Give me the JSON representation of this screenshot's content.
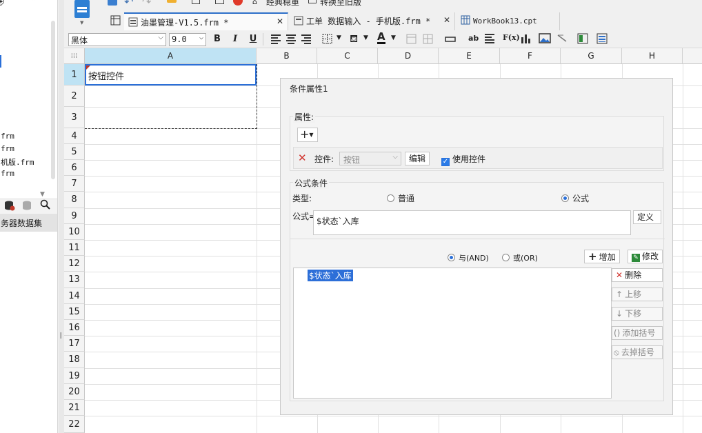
{
  "left_panel": {
    "files": [
      "frm",
      "frm",
      "机版.frm",
      "frm"
    ],
    "datasource_label": "务器数据集"
  },
  "toolbar": {
    "classic_label": "经典稳重",
    "old_version_label": "转换至旧版"
  },
  "tabs": [
    {
      "label": "油墨管理-V1.5.frm *",
      "active": true,
      "closable": true
    },
    {
      "label": "工单 数据输入 - 手机版.frm *",
      "active": false,
      "closable": true
    },
    {
      "label": "WorkBook13.cpt",
      "active": false,
      "closable": false
    }
  ],
  "format_bar": {
    "font": "黑体",
    "size": "9.0",
    "bold": "B",
    "italic": "I",
    "underline": "U"
  },
  "sheet": {
    "corner": "⁞⁞⁞",
    "columns": [
      "A",
      "B",
      "C",
      "D",
      "E",
      "F",
      "G",
      "H"
    ],
    "rows": [
      "1",
      "2",
      "3",
      "4",
      "5",
      "6",
      "7",
      "8",
      "9",
      "10",
      "11",
      "12",
      "13",
      "14",
      "15",
      "16",
      "17",
      "18",
      "19",
      "20",
      "21",
      "22"
    ],
    "cell_a1": "按钮控件"
  },
  "dialog": {
    "title": "条件属性1",
    "property_label": "属性:",
    "add_symbol": "+",
    "control_label": "控件:",
    "control_value": "按钮",
    "edit_button": "编辑",
    "use_control_label": "使用控件",
    "formula_condition_label": "公式条件",
    "type_label": "类型:",
    "type_normal": "普通",
    "type_formula": "公式",
    "formula_label": "公式=",
    "formula_value": "$状态`入库",
    "define_button": "定义",
    "and_label": "与(AND)",
    "or_label": "或(OR)",
    "add_button": "增加",
    "modify_button": "修改",
    "condition_items": [
      "$状态`入库"
    ],
    "delete_button": "删除",
    "move_up_button": "上移",
    "move_down_button": "下移",
    "add_bracket_button": "添加括号",
    "remove_bracket_button": "去掉括号"
  }
}
